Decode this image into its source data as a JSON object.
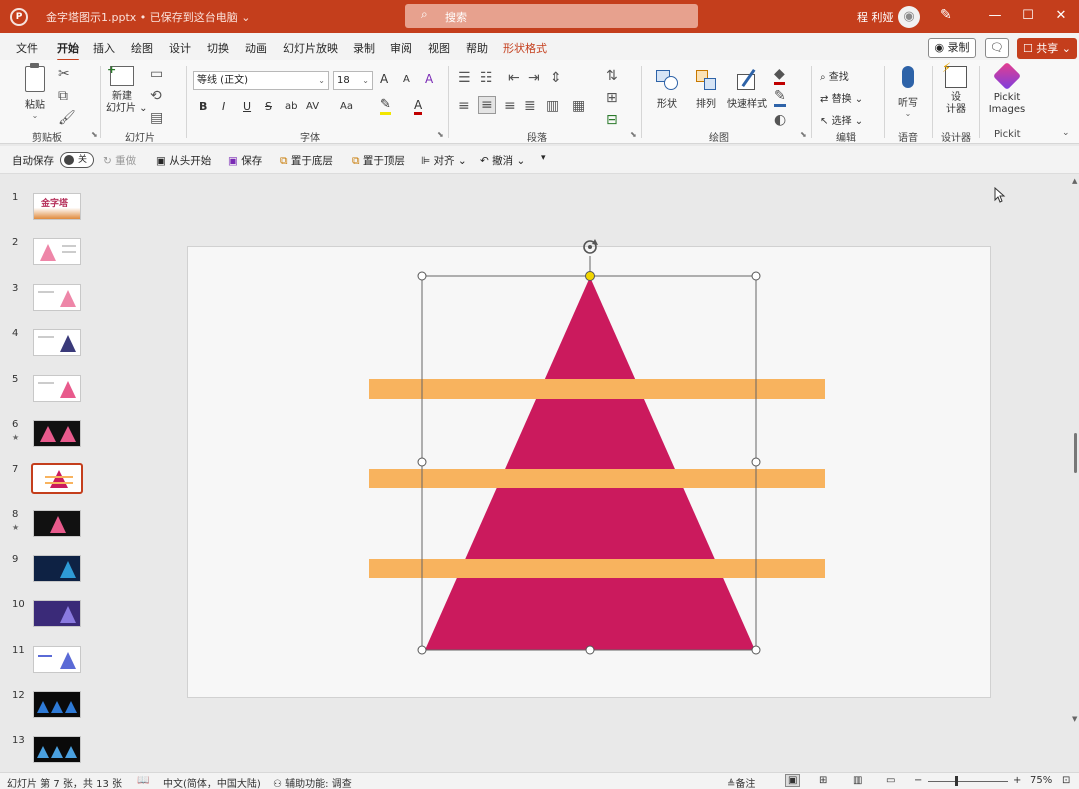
{
  "titlebar": {
    "logo_letter": "P",
    "doc_title": "金字塔图示1.pptx • 已保存到这台电脑 ⌄",
    "search_placeholder": "搜索",
    "user_name": "程 利娅",
    "avatar_icon": "person-icon",
    "min": "—",
    "max": "☐",
    "close": "✕"
  },
  "menu": {
    "tabs": [
      "文件",
      "开始",
      "插入",
      "绘图",
      "设计",
      "切换",
      "动画",
      "幻灯片放映",
      "录制",
      "审阅",
      "视图",
      "帮助",
      "形状格式"
    ],
    "active_tab": "开始",
    "contextual_tab": "形状格式",
    "record": "◉ 录制",
    "comment": "🗨",
    "share": "☐ 共享 ⌄"
  },
  "ribbon": {
    "groups": {
      "clipboard": "剪贴板",
      "slides": "幻灯片",
      "font": "字体",
      "paragraph": "段落",
      "drawing": "绘图",
      "editing": "编辑",
      "voice": "语音",
      "designer": "设计器",
      "pickit": "Pickit"
    },
    "paste": "粘贴",
    "new_slide": "新建\n幻灯片 ⌄",
    "font_name": "等线 (正文)",
    "font_size": "18",
    "bold": "B",
    "italic": "I",
    "underline": "U",
    "strike": "S",
    "shadow": "ab",
    "spacing": "AV",
    "case": "Aa",
    "font_color": "A",
    "grow": "A",
    "shrink": "A",
    "clear": "A",
    "shapes": "形状",
    "arrange": "排列",
    "quick_styles": "快速样式",
    "find": "查找",
    "replace": "替换",
    "select": "选择",
    "dictate": "听写",
    "designer": "设\n计器",
    "pickit": "Pickit\nImages"
  },
  "qat": {
    "autosave": "自动保存",
    "toggle": "关",
    "redo": "重做",
    "from_start": "从头开始",
    "save": "保存",
    "bring_down": "置于底层",
    "bring_top": "置于顶层",
    "align": "对齐",
    "undo": "撤消"
  },
  "thumbnails": [
    {
      "num": "1",
      "star": "",
      "title": "金字塔"
    },
    {
      "num": "2",
      "star": "",
      "title": ""
    },
    {
      "num": "3",
      "star": "",
      "title": ""
    },
    {
      "num": "4",
      "star": "",
      "title": ""
    },
    {
      "num": "5",
      "star": "",
      "title": ""
    },
    {
      "num": "6",
      "star": "★",
      "title": ""
    },
    {
      "num": "7",
      "star": "",
      "title": ""
    },
    {
      "num": "8",
      "star": "★",
      "title": ""
    },
    {
      "num": "9",
      "star": "",
      "title": ""
    },
    {
      "num": "10",
      "star": "",
      "title": ""
    },
    {
      "num": "11",
      "star": "",
      "title": ""
    },
    {
      "num": "12",
      "star": "",
      "title": ""
    },
    {
      "num": "13",
      "star": "",
      "title": ""
    }
  ],
  "colors": {
    "accent": "#c43e1c",
    "triangle": "#cb1a5d",
    "bars": "#f8b35e",
    "handle_yellow": "#f2d600"
  },
  "status": {
    "slide_info": "幻灯片 第 7 张，共 13 张",
    "language": "中文(简体，中国大陆)",
    "accessibility": "辅助功能: 调查",
    "notes": "备注",
    "zoom": "75%",
    "minus": "−",
    "plus": "+"
  }
}
